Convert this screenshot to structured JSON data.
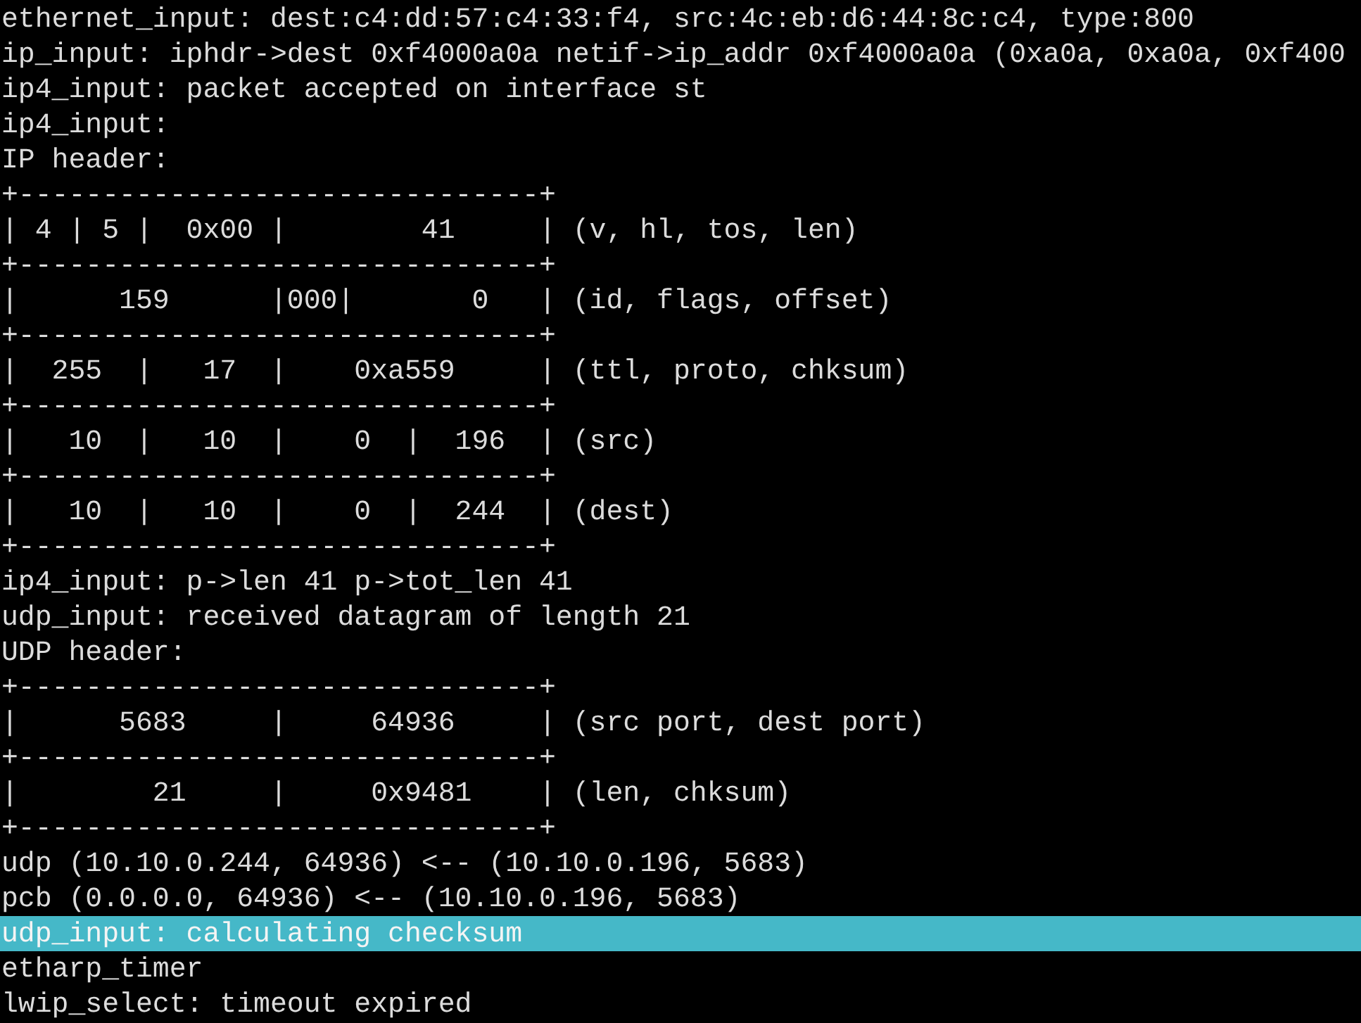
{
  "terminal": {
    "lines": [
      {
        "text": "ethernet_input: dest:c4:dd:57:c4:33:f4, src:4c:eb:d6:44:8c:c4, type:800",
        "selected": false
      },
      {
        "text": "ip_input: iphdr->dest 0xf4000a0a netif->ip_addr 0xf4000a0a (0xa0a, 0xa0a, 0xf400",
        "selected": false
      },
      {
        "text": "ip4_input: packet accepted on interface st",
        "selected": false
      },
      {
        "text": "ip4_input:",
        "selected": false
      },
      {
        "text": "IP header:",
        "selected": false
      },
      {
        "text": "+-------------------------------+",
        "selected": false
      },
      {
        "text": "| 4 | 5 |  0x00 |        41     | (v, hl, tos, len)",
        "selected": false
      },
      {
        "text": "+-------------------------------+",
        "selected": false
      },
      {
        "text": "|      159      |000|       0   | (id, flags, offset)",
        "selected": false
      },
      {
        "text": "+-------------------------------+",
        "selected": false
      },
      {
        "text": "|  255  |   17  |    0xa559     | (ttl, proto, chksum)",
        "selected": false
      },
      {
        "text": "+-------------------------------+",
        "selected": false
      },
      {
        "text": "|   10  |   10  |    0  |  196  | (src)",
        "selected": false
      },
      {
        "text": "+-------------------------------+",
        "selected": false
      },
      {
        "text": "|   10  |   10  |    0  |  244  | (dest)",
        "selected": false
      },
      {
        "text": "+-------------------------------+",
        "selected": false
      },
      {
        "text": "ip4_input: p->len 41 p->tot_len 41",
        "selected": false
      },
      {
        "text": "udp_input: received datagram of length 21",
        "selected": false
      },
      {
        "text": "UDP header:",
        "selected": false
      },
      {
        "text": "+-------------------------------+",
        "selected": false
      },
      {
        "text": "|      5683     |     64936     | (src port, dest port)",
        "selected": false
      },
      {
        "text": "+-------------------------------+",
        "selected": false
      },
      {
        "text": "|        21     |     0x9481    | (len, chksum)",
        "selected": false
      },
      {
        "text": "+-------------------------------+",
        "selected": false
      },
      {
        "text": "udp (10.10.0.244, 64936) <-- (10.10.0.196, 5683)",
        "selected": false
      },
      {
        "text": "pcb (0.0.0.0, 64936) <-- (10.10.0.196, 5683)",
        "selected": false
      },
      {
        "text": "udp_input: calculating checksum",
        "selected": true
      },
      {
        "text": "etharp_timer",
        "selected": false
      },
      {
        "text": "lwip_select: timeout expired",
        "selected": false
      }
    ]
  }
}
